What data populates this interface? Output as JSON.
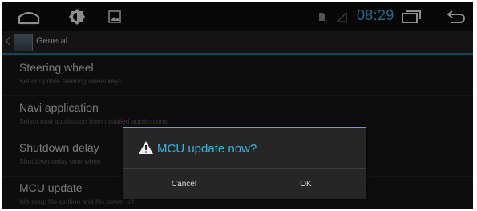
{
  "status_bar": {
    "time": "08:29",
    "accent_color": "#33b5e5",
    "icons": [
      "home-icon",
      "brightness-icon",
      "gallery-icon",
      "sim-icon",
      "signal-icon",
      "recent-apps-icon",
      "back-icon"
    ]
  },
  "action_bar": {
    "title": "General"
  },
  "settings": [
    {
      "title": "Steering wheel",
      "subtitle": "Set or update steering wheel keys"
    },
    {
      "title": "Navi application",
      "subtitle": "Select navi application from installed applications"
    },
    {
      "title": "Shutdown delay",
      "subtitle": "Shutdown delay time when"
    },
    {
      "title": "MCU update",
      "subtitle": "Warning: No ignition and No power off"
    }
  ],
  "dialog": {
    "title": "MCU update now?",
    "icon": "warning-icon",
    "cancel_label": "Cancel",
    "ok_label": "OK"
  }
}
